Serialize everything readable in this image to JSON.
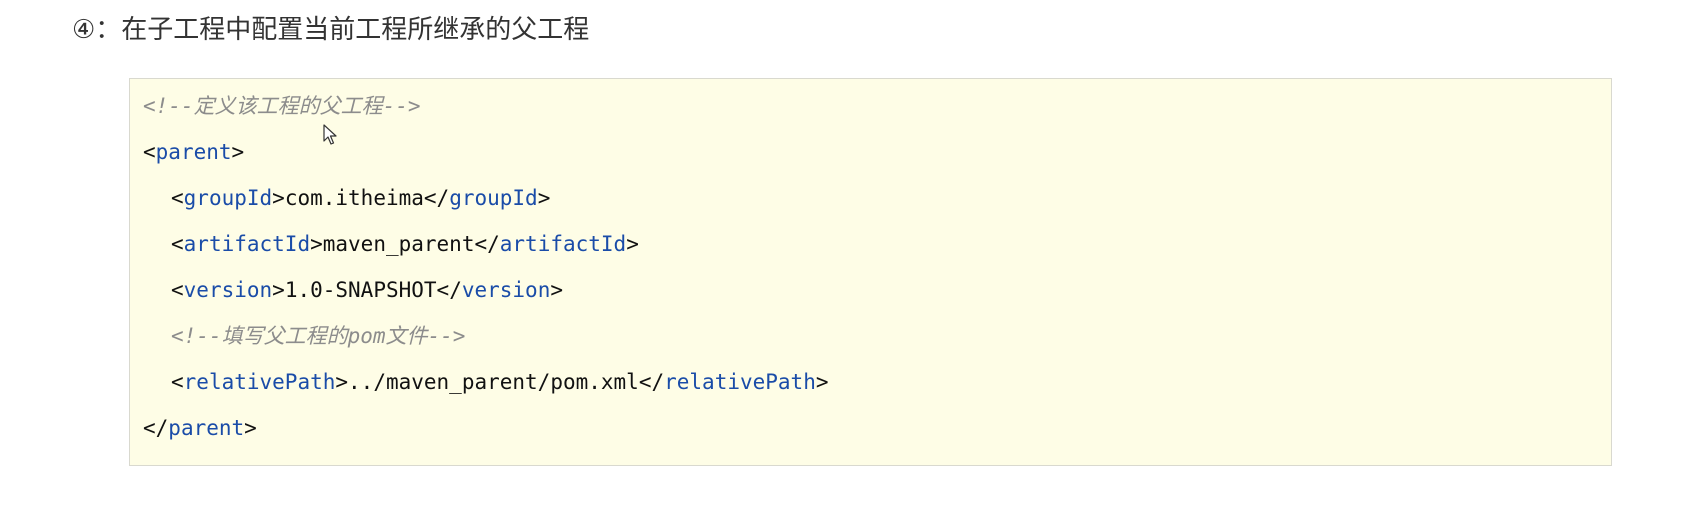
{
  "heading": "④：在子工程中配置当前工程所继承的父工程",
  "code": {
    "comment_define": "<!--定义该工程的父工程-->",
    "parent_tag": "parent",
    "group_id_tag": "groupId",
    "group_id_value": "com.itheima",
    "artifact_id_tag": "artifactId",
    "artifact_id_value": "maven_parent",
    "version_tag": "version",
    "version_value": "1.0-SNAPSHOT",
    "comment_pom": "<!--填写父工程的pom文件-->",
    "relative_path_tag": "relativePath",
    "relative_path_value": "../maven_parent/pom.xml"
  },
  "colors": {
    "tag": "#1a4ca8",
    "comment": "#8c8c8c",
    "code_background": "#fefde6",
    "code_border": "#d9d9cf"
  },
  "icons": {
    "mouse_cursor": "arrow-cursor-icon"
  }
}
